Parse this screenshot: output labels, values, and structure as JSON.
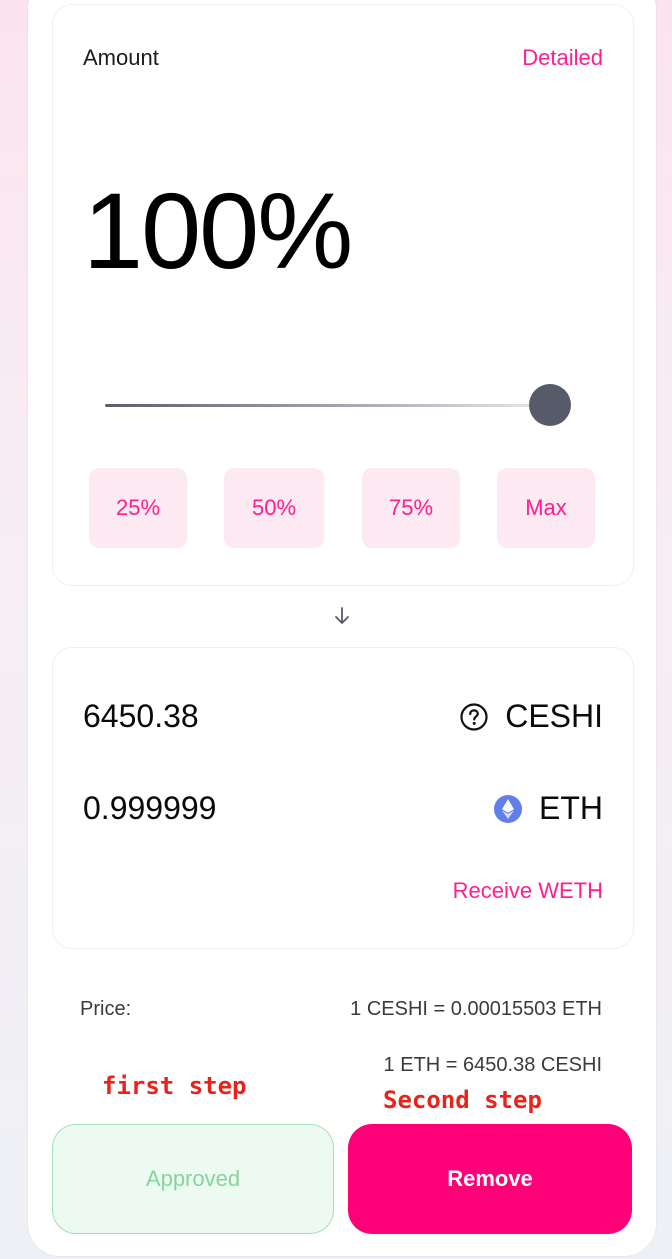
{
  "amount_card": {
    "label": "Amount",
    "detailed_link": "Detailed",
    "percent_display": "100%",
    "slider_value_percent": 100,
    "presets": [
      "25%",
      "50%",
      "75%",
      "Max"
    ]
  },
  "output_card": {
    "tokens": [
      {
        "amount": "6450.38",
        "symbol": "CESHI",
        "icon": "question-circle-icon"
      },
      {
        "amount": "0.999999",
        "symbol": "ETH",
        "icon": "ethereum-icon"
      }
    ],
    "receive_link": "Receive WETH"
  },
  "price": {
    "label": "Price:",
    "line1": "1 CESHI = 0.00015503 ETH",
    "line2": "1 ETH = 6450.38 CESHI"
  },
  "annotations": {
    "first_step": "first step",
    "second_step": "Second step"
  },
  "actions": {
    "approved_label": "Approved",
    "remove_label": "Remove"
  },
  "colors": {
    "accent": "#ff1f8e",
    "remove_button": "#ff0079",
    "approved_bg": "#ecfaf1",
    "approved_text": "#85d4a0",
    "annotation": "#e8231b"
  }
}
